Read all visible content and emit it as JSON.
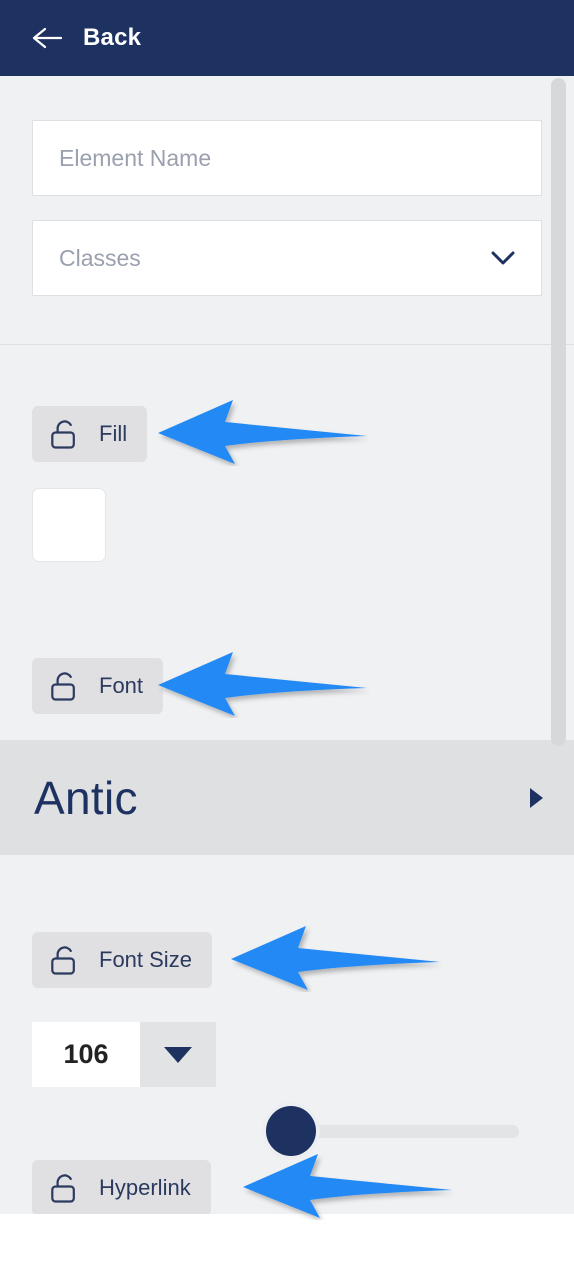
{
  "header": {
    "back_label": "Back",
    "back_icon": "arrow-left-icon",
    "background_color": "#1e3262"
  },
  "fields": [
    {
      "name": "element-name",
      "placeholder": "Element Name",
      "value": ""
    },
    {
      "name": "classes",
      "placeholder": "Classes",
      "value": "",
      "icon": "chevron-down-icon"
    }
  ],
  "sections": {
    "fill": {
      "label": "Fill",
      "lock_icon": "lock-open-icon",
      "swatch_color": "#ffffff"
    },
    "font": {
      "label": "Font",
      "lock_icon": "lock-open-icon",
      "family": "Antic",
      "expand_icon": "triangle-right-icon"
    },
    "font_size": {
      "label": "Font Size",
      "lock_icon": "lock-open-icon",
      "value": "106",
      "dropdown_icon": "triangle-down-icon",
      "slider_position_percent": 0
    },
    "hyperlink": {
      "label": "Hyperlink",
      "lock_icon": "lock-open-icon"
    }
  },
  "annotations": {
    "color": "#2089f5",
    "arrows": [
      {
        "name": "arrow-pointing-to-fill",
        "target": "Fill"
      },
      {
        "name": "arrow-pointing-to-font",
        "target": "Font"
      },
      {
        "name": "arrow-pointing-to-font-size",
        "target": "Font Size"
      },
      {
        "name": "arrow-pointing-to-hyperlink",
        "target": "Hyperlink"
      }
    ]
  },
  "scrollbar": {
    "name": "vertical-scrollbar",
    "thumb_color": "#d6d8da"
  }
}
